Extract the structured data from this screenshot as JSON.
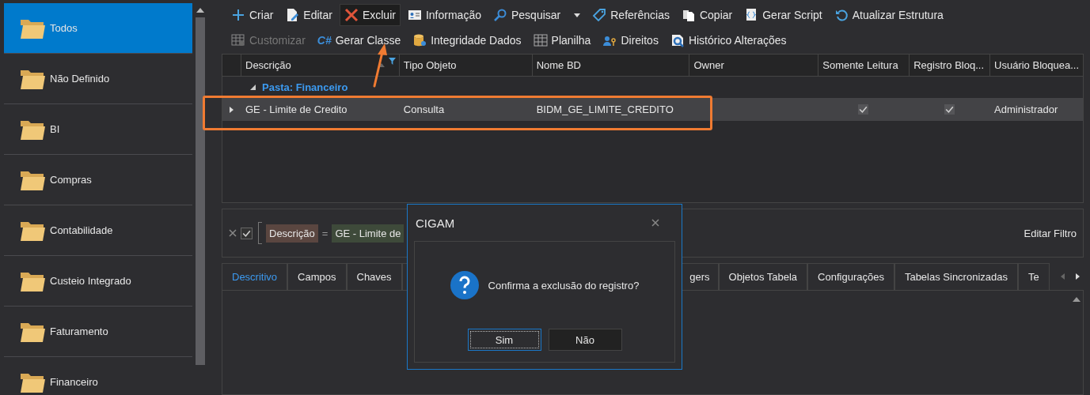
{
  "sidebar": {
    "items": [
      {
        "label": "Todos",
        "selected": true
      },
      {
        "label": "Não Definido",
        "selected": false
      },
      {
        "label": "BI",
        "selected": false
      },
      {
        "label": "Compras",
        "selected": false
      },
      {
        "label": "Contabilidade",
        "selected": false
      },
      {
        "label": "Custeio Integrado",
        "selected": false
      },
      {
        "label": "Faturamento",
        "selected": false
      },
      {
        "label": "Financeiro",
        "selected": false
      }
    ]
  },
  "toolbar": {
    "top_row": [
      {
        "kind": "button",
        "label": "Criar",
        "disabled": false,
        "selected": false
      },
      {
        "kind": "button",
        "label": "Editar",
        "disabled": false,
        "selected": false
      },
      {
        "kind": "button",
        "label": "Excluir",
        "disabled": false,
        "selected": true
      },
      {
        "kind": "button",
        "label": "Informação",
        "disabled": false,
        "selected": false
      },
      {
        "kind": "split",
        "label": "Pesquisar",
        "disabled": false,
        "selected": false
      },
      {
        "kind": "button",
        "label": "Referências",
        "disabled": false,
        "selected": false
      },
      {
        "kind": "button",
        "label": "Copiar",
        "disabled": false,
        "selected": false
      },
      {
        "kind": "button",
        "label": "Gerar Script",
        "disabled": false,
        "selected": false
      },
      {
        "kind": "button",
        "label": "Atualizar Estrutura",
        "disabled": false,
        "selected": false
      }
    ],
    "bottom_row": [
      {
        "kind": "button",
        "label": "Customizar",
        "disabled": true,
        "selected": false
      },
      {
        "kind": "glyph",
        "glyph": "C#",
        "label": "Gerar Classe",
        "disabled": false,
        "selected": false
      },
      {
        "kind": "button",
        "label": "Integridade Dados",
        "disabled": false,
        "selected": false
      },
      {
        "kind": "button",
        "label": "Planilha",
        "disabled": false,
        "selected": false
      },
      {
        "kind": "button",
        "label": "Direitos",
        "disabled": false,
        "selected": false
      },
      {
        "kind": "button",
        "label": "Histórico Alterações",
        "disabled": false,
        "selected": false
      }
    ]
  },
  "grid": {
    "columns": [
      {
        "label": "Descrição",
        "kind": "text",
        "sorted": true,
        "filtered": true
      },
      {
        "label": "Tipo Objeto",
        "kind": "text",
        "sorted": false,
        "filtered": false
      },
      {
        "label": "Nome BD",
        "kind": "text",
        "sorted": false,
        "filtered": false
      },
      {
        "label": "Owner",
        "kind": "text",
        "sorted": false,
        "filtered": false
      },
      {
        "label": "Somente Leitura",
        "kind": "check",
        "sorted": false,
        "filtered": false
      },
      {
        "label": "Registro Bloq...",
        "kind": "check",
        "sorted": false,
        "filtered": false
      },
      {
        "label": "Usuário Bloquea...",
        "kind": "text",
        "sorted": false,
        "filtered": false
      }
    ],
    "groups": [
      {
        "label": "Pasta: Financeiro",
        "expanded": true,
        "rows": [
          {
            "selected": true,
            "descricao": "GE - Limite de Credito",
            "tipo_objeto": "Consulta",
            "nome_bd": "BIDM_GE_LIMITE_CREDITO",
            "somente_leitura": true,
            "registro_bloqueado": true,
            "usuario_bloqueador": "Administrador"
          }
        ]
      }
    ]
  },
  "filter": {
    "enabled": true,
    "field": "Descrição",
    "operator": "=",
    "value": "GE - Limite de",
    "edit_label": "Editar Filtro"
  },
  "tabs": [
    {
      "label": "Descritivo",
      "selected": true
    },
    {
      "label": "Campos",
      "selected": false
    },
    {
      "label": "Chaves",
      "selected": false
    },
    {
      "label": "gers",
      "selected": false
    },
    {
      "label": "Objetos Tabela",
      "selected": false
    },
    {
      "label": "Configurações",
      "selected": false
    },
    {
      "label": "Tabelas Sincronizadas",
      "selected": false
    },
    {
      "label": "Te",
      "selected": false
    }
  ],
  "dialog": {
    "title": "CIGAM",
    "message": "Confirma a exclusão do registro?",
    "buttons": [
      {
        "label": "Sim",
        "focused": true
      },
      {
        "label": "Não",
        "focused": false
      }
    ]
  }
}
